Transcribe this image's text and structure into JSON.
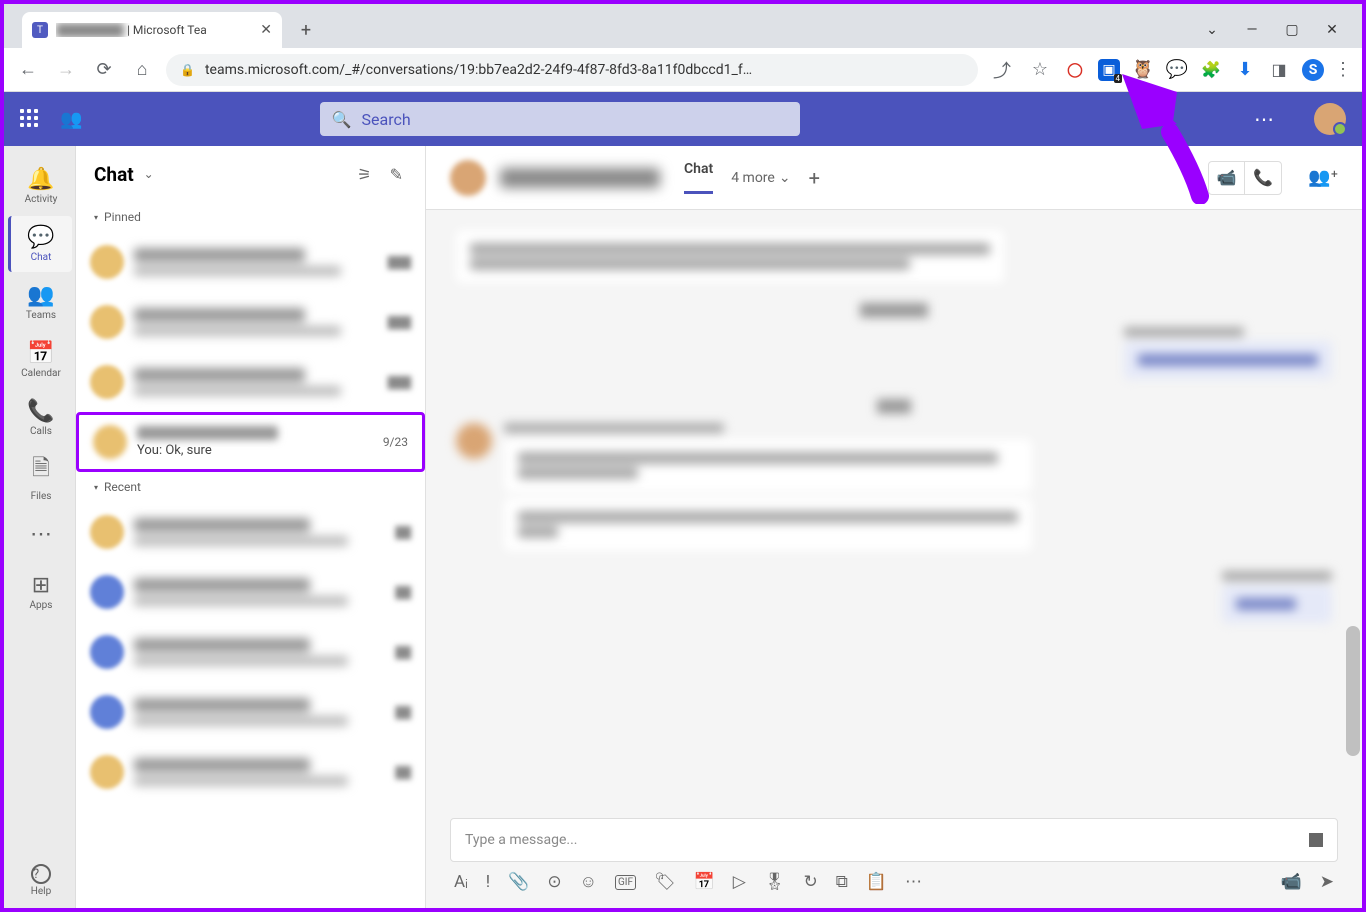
{
  "browser": {
    "tab_title_suffix": " | Microsoft Tea",
    "url": "teams.microsoft.com/_#/conversations/19:bb7ea2d2-24f9-4f87-8fd3-8a11f0dbccd1_f…",
    "ext_badge": "4"
  },
  "teams_bar": {
    "search_placeholder": "Search"
  },
  "rail": {
    "items": [
      {
        "label": "Activity",
        "icon": "🔔"
      },
      {
        "label": "Chat",
        "icon": "💬"
      },
      {
        "label": "Teams",
        "icon": "👥"
      },
      {
        "label": "Calendar",
        "icon": "📅"
      },
      {
        "label": "Calls",
        "icon": "📞"
      },
      {
        "label": "Files",
        "icon": "🗎"
      }
    ],
    "more": "⋯",
    "apps": {
      "label": "Apps",
      "icon": "⊞"
    },
    "help": {
      "label": "Help",
      "icon": "?"
    }
  },
  "chat_panel": {
    "title": "Chat",
    "section_pinned": "Pinned",
    "section_recent": "Recent",
    "highlighted": {
      "preview": "You: Ok, sure",
      "date": "9/23"
    }
  },
  "conversation": {
    "tab_chat": "Chat",
    "more_tabs": "4 more",
    "compose_placeholder": "Type a message..."
  }
}
